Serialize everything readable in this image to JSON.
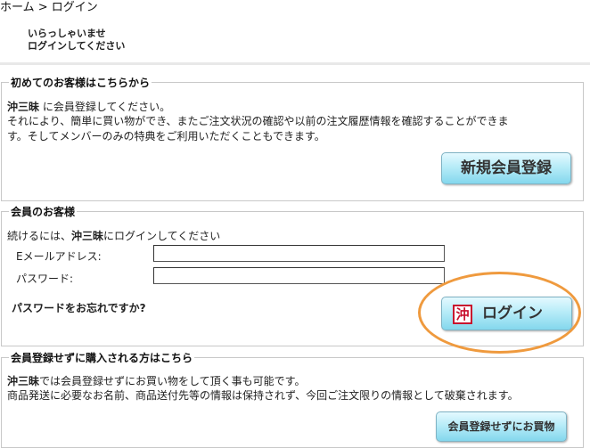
{
  "breadcrumb": "ホーム > ログイン",
  "greeting": [
    "いらっしゃいませ",
    "ログインしてください"
  ],
  "new_customer": {
    "legend": "初めてのお客様はこちらから",
    "shop": "沖三昧",
    "line1": " に会員登録してください。",
    "line2": "それにより、簡単に買い物ができ、またご注文状況の確認や以前の注文履歴情報を確認することができま",
    "line3": "す。そしてメンバーのみの特典をご利用いただくこともできます。",
    "button": "新規会員登録"
  },
  "member": {
    "legend": "会員のお客様",
    "intro_pre": "続けるには、",
    "shop": "沖三昧",
    "intro_post": "にログインしてください",
    "email_label": "Eメールアドレス:",
    "password_label": "パスワード:",
    "email_value": "",
    "password_value": "",
    "forgot": "パスワードをお忘れですか?",
    "login_button": "ログイン",
    "login_icon_char": "沖",
    "login_icon": "okinawa-logo-icon"
  },
  "guest": {
    "legend": "会員登録せずに購入される方はこちら",
    "shop": "沖三昧",
    "line1": "では会員登録せずにお買い物をして頂く事も可能です。",
    "line2": "商品発送に必要なお名前、商品送付先等の情報は保持されず、今回ご注文限りの情報として破棄されます。",
    "button": "会員登録せずにお買物"
  },
  "colors": {
    "highlight_oval": "#ef9a3e",
    "button_gradient": "#b7ecf8",
    "icon_red": "#c8102e"
  }
}
